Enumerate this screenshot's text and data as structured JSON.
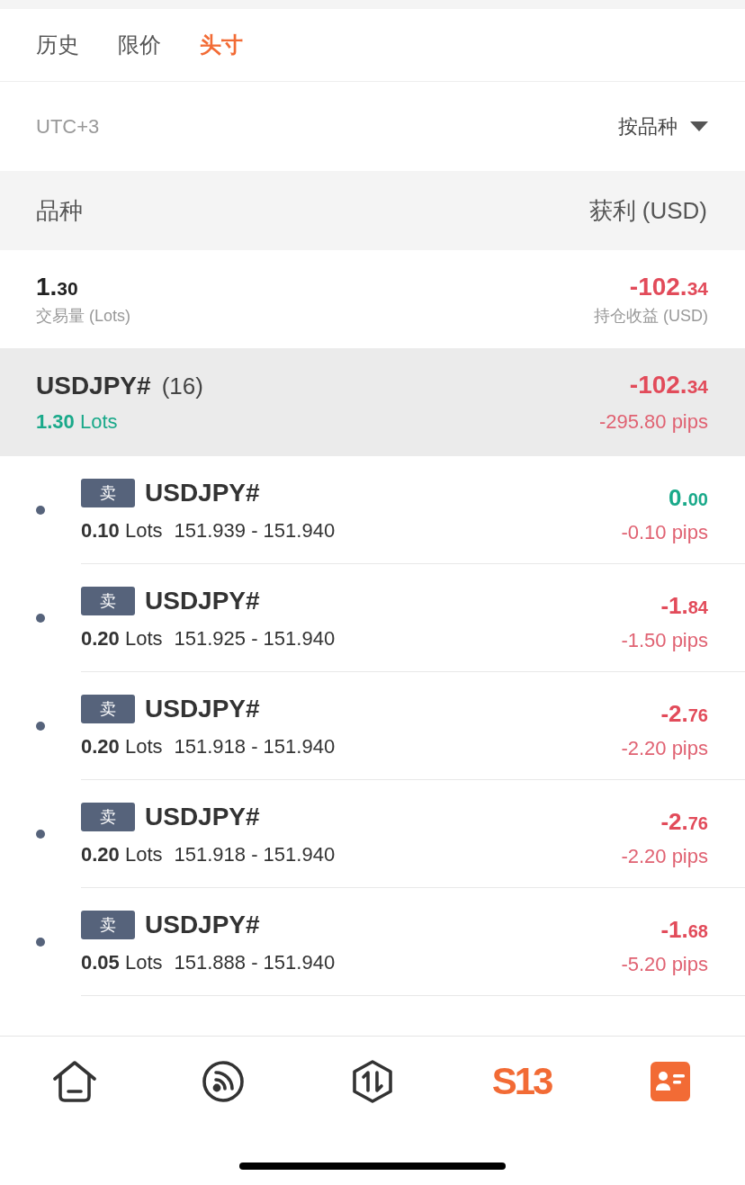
{
  "tabs": [
    {
      "label": "历史",
      "selected": false
    },
    {
      "label": "限价",
      "selected": false
    },
    {
      "label": "头寸",
      "selected": true
    }
  ],
  "filter": {
    "timezone": "UTC+3",
    "sort_label": "按品种"
  },
  "table_header": {
    "column_1": "品种",
    "column_2": "获利 (USD)"
  },
  "summary": {
    "volume": "1.30",
    "volume_label": "交易量 (Lots)",
    "profit": "-102.34",
    "profit_label": "持仓收益 (USD)"
  },
  "group": {
    "symbol": "USDJPY#",
    "count": "(16)",
    "lots": "**1.30** Lots",
    "profit": "-102.34",
    "pips": "-295.80 pips"
  },
  "positions": [
    {
      "side": "卖",
      "symbol": "USDJPY#",
      "lots": "**0.10** Lots",
      "prices": "151.939 - 151.940",
      "profit": "0.00",
      "color": "#1aa98a",
      "pips": "-0.10 pips"
    },
    {
      "side": "卖",
      "symbol": "USDJPY#",
      "lots": "**0.20** Lots",
      "prices": "151.925 - 151.940",
      "profit": "-1.84",
      "color": "#e24b5a",
      "pips": "-1.50 pips"
    },
    {
      "side": "卖",
      "symbol": "USDJPY#",
      "lots": "**0.20** Lots",
      "prices": "151.918 - 151.940",
      "profit": "-2.76",
      "color": "#e24b5a",
      "pips": "-2.20 pips"
    },
    {
      "side": "卖",
      "symbol": "USDJPY#",
      "lots": "**0.20** Lots",
      "prices": "151.918 - 151.940",
      "profit": "-2.76",
      "color": "#e24b5a",
      "pips": "-2.20 pips"
    },
    {
      "side": "卖",
      "symbol": "USDJPY#",
      "lots": "**0.05** Lots",
      "prices": "151.888 - 151.940",
      "profit": "-1.68",
      "color": "#e24b5a",
      "pips": "-5.20 pips"
    }
  ],
  "nav": [
    {
      "kind": "home",
      "selected": false
    },
    {
      "kind": "feed",
      "selected": false
    },
    {
      "kind": "trade",
      "selected": false
    },
    {
      "kind": "logo",
      "label": "S13",
      "selected": false
    },
    {
      "kind": "account",
      "selected": true
    }
  ]
}
